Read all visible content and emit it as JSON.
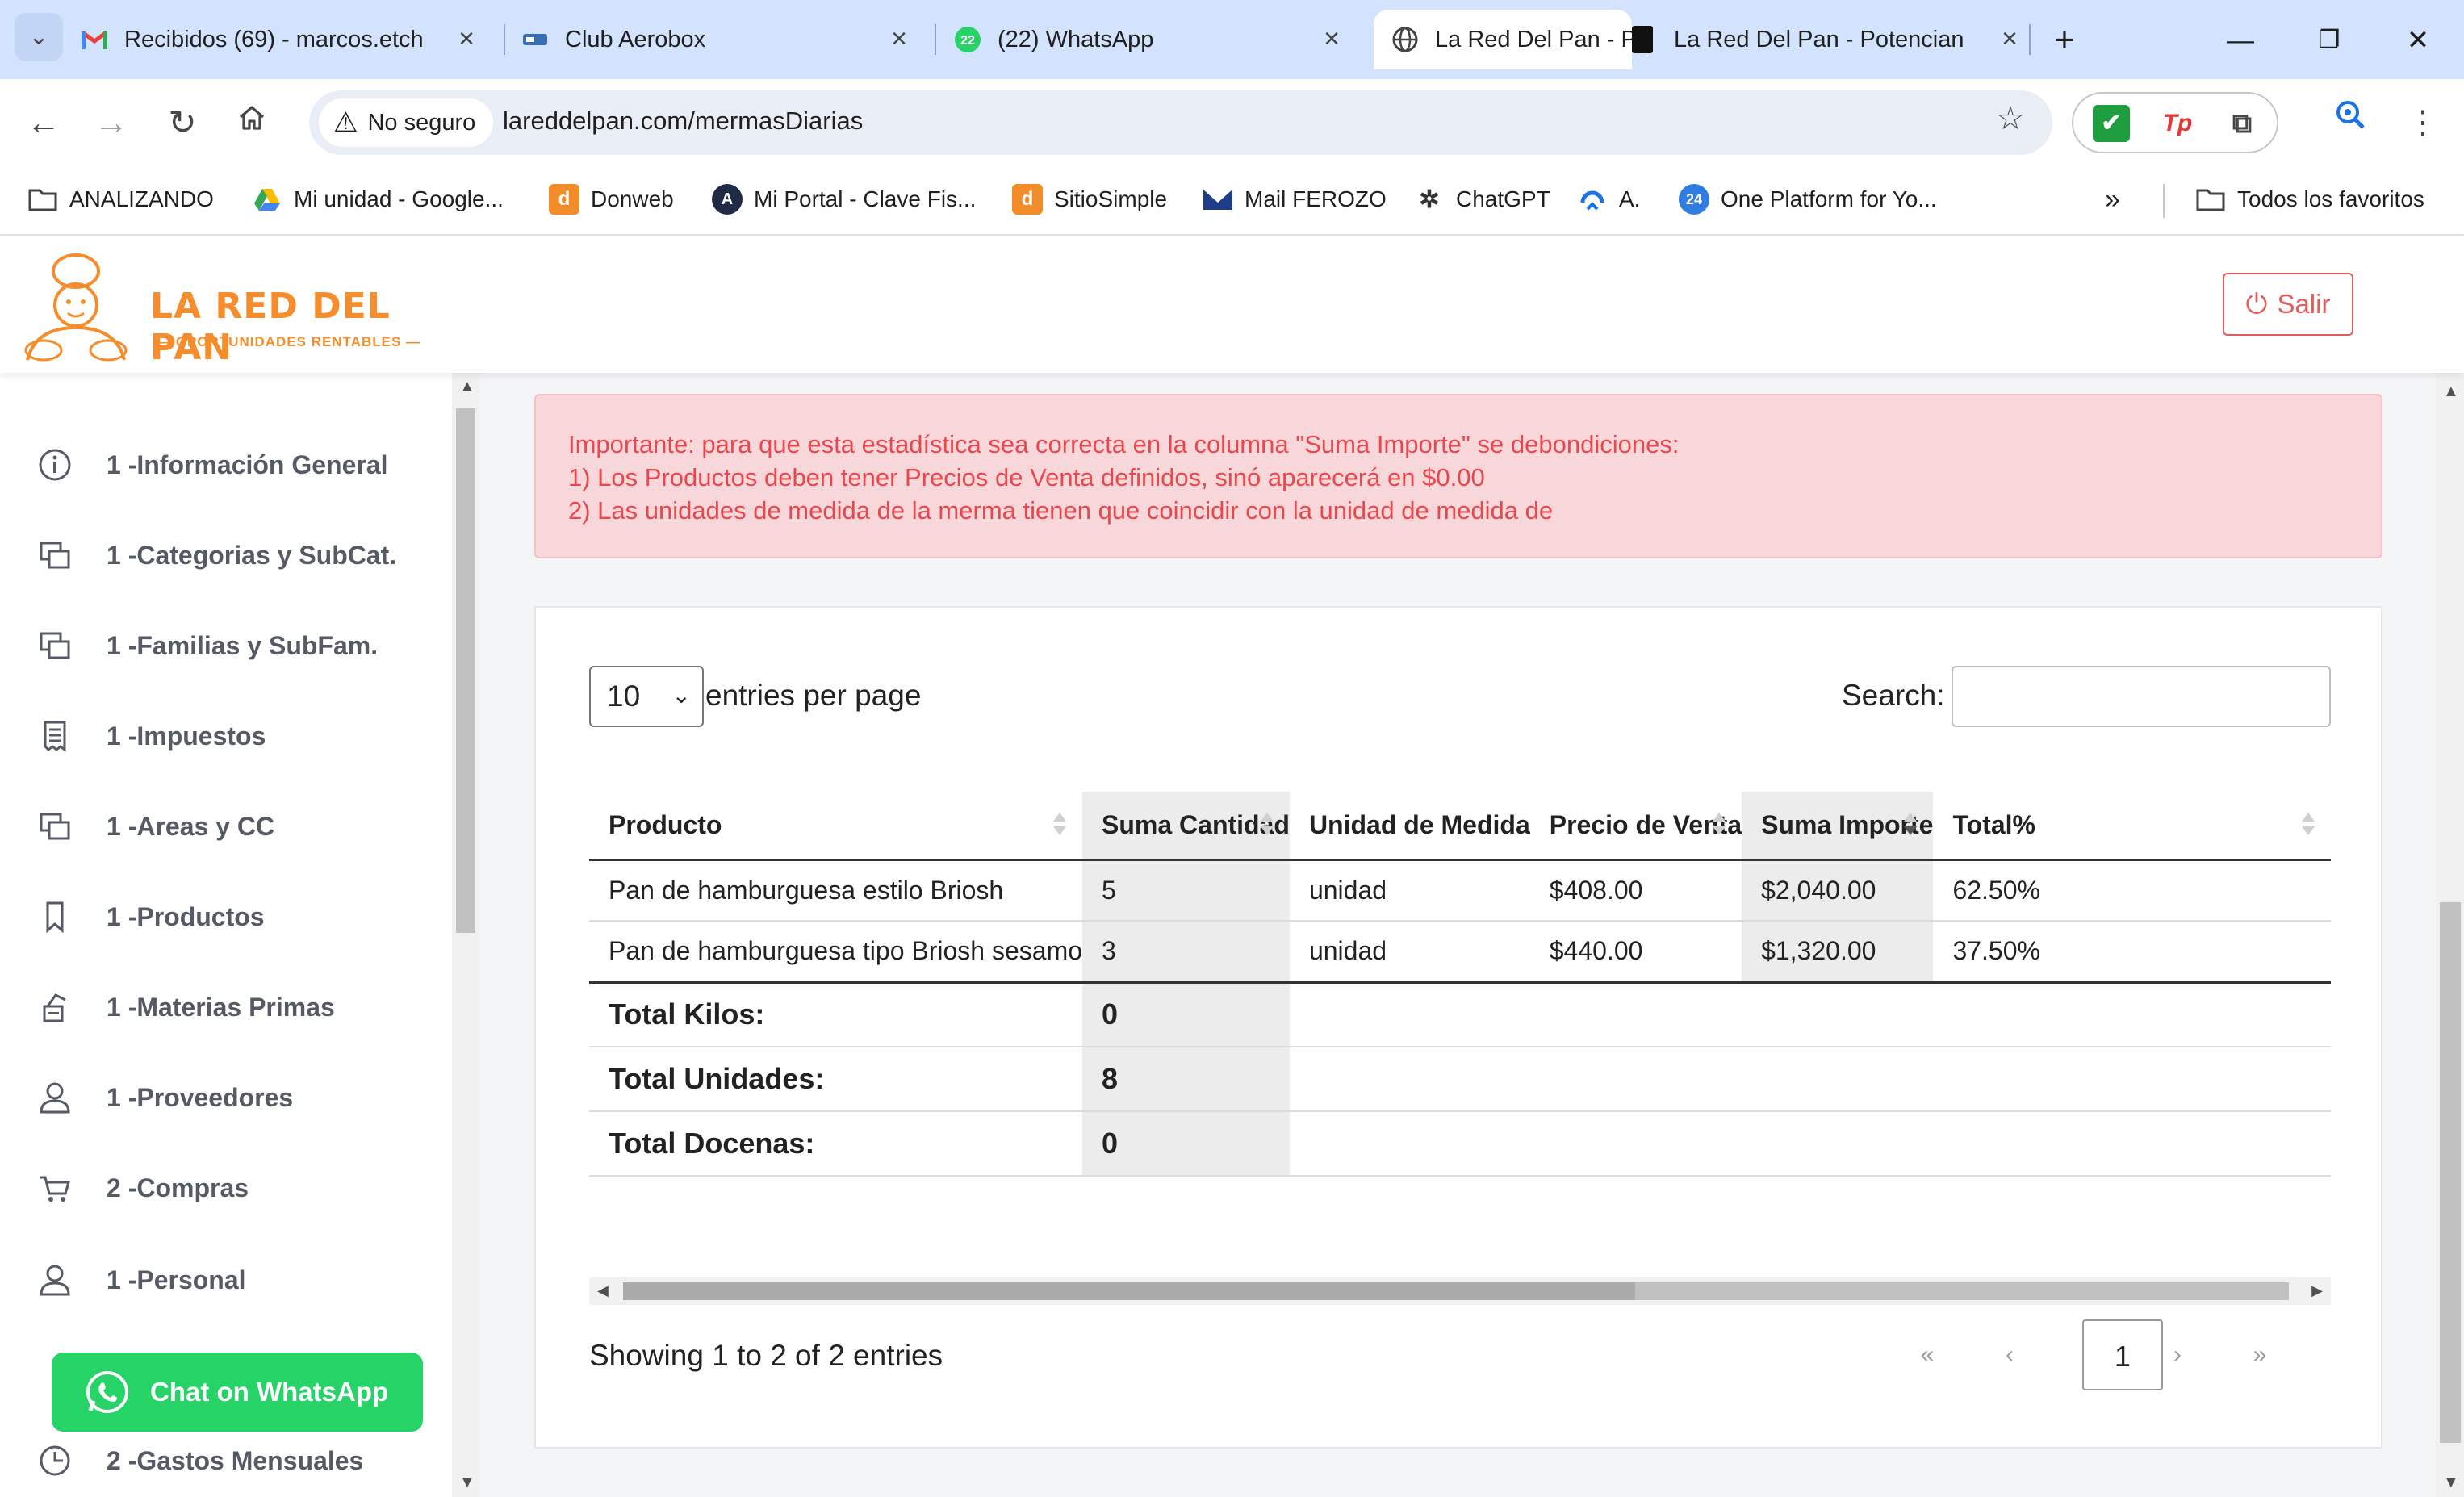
{
  "browser": {
    "tabs": [
      {
        "title": "Recibidos (69) - marcos.etch",
        "icon": "gmail-icon"
      },
      {
        "title": "Club Aerobox",
        "icon": "club-icon"
      },
      {
        "title": "(22) WhatsApp",
        "icon": "whatsapp-icon",
        "badge": "22"
      },
      {
        "title": "La Red Del Pan - Pa",
        "icon": "globe-icon",
        "active": true
      },
      {
        "title": "La Red Del Pan - Potenciand",
        "icon": "site-icon"
      }
    ],
    "new_tab": "+",
    "window_controls": {
      "minimize": "—",
      "restore": "❐",
      "close": "✕"
    },
    "security_label": "No seguro",
    "url": "lareddelpan.com/mermasDiarias",
    "bookmarks": [
      {
        "label": "ANALIZANDO",
        "icon": "folder-icon"
      },
      {
        "label": "Mi unidad - Google...",
        "icon": "drive-icon"
      },
      {
        "label": "Donweb",
        "icon": "donweb-icon"
      },
      {
        "label": "Mi Portal - Clave Fis...",
        "icon": "portal-icon"
      },
      {
        "label": "SitioSimple",
        "icon": "sitiosimple-icon"
      },
      {
        "label": "Mail FEROZO",
        "icon": "mail-icon"
      },
      {
        "label": "ChatGPT",
        "icon": "chatgpt-icon"
      },
      {
        "label": "A.",
        "icon": "a-icon"
      },
      {
        "label": "One Platform for Yo...",
        "icon": "platform-icon"
      }
    ],
    "bookmarks_overflow": "»",
    "all_bookmarks": "Todos los favoritos"
  },
  "site": {
    "logo_text": "LA RED DEL PAN",
    "logo_sub": "OPORTUNIDADES RENTABLES",
    "logout_label": "Salir"
  },
  "sidebar": {
    "items": [
      {
        "label": "1 -Información General",
        "icon": "info-icon"
      },
      {
        "label": "1 -Categorias y SubCat.",
        "icon": "copy-icon"
      },
      {
        "label": "1 -Familias y SubFam.",
        "icon": "copy-icon"
      },
      {
        "label": "1 -Impuestos",
        "icon": "receipt-icon"
      },
      {
        "label": "1 -Areas y CC",
        "icon": "copy-icon"
      },
      {
        "label": "1 -Productos",
        "icon": "bookmark-icon"
      },
      {
        "label": "1 -Materias Primas",
        "icon": "ingredients-icon"
      },
      {
        "label": "1 -Proveedores",
        "icon": "user-icon"
      },
      {
        "label": "2 -Compras",
        "icon": "cart-icon"
      },
      {
        "label": "1 -Personal",
        "icon": "user-icon"
      },
      {
        "label": "2 -Gastos Mensuales",
        "icon": "clock-icon"
      }
    ],
    "whatsapp_label": "Chat on WhatsApp"
  },
  "alert": {
    "lines": [
      "Importante: para que esta estadística sea correcta en la columna \"Suma Importe\" se debondiciones:",
      "1) Los Productos deben tener Precios de Venta definidos, sinó aparecerá en $0.00",
      "2) Las unidades de medida de la merma tienen que coincidir con la unidad de medida de"
    ]
  },
  "table": {
    "page_length": "10",
    "length_label": "entries per page",
    "search_label": "Search:",
    "search_value": "",
    "columns": [
      "Producto",
      "Suma Cantidad",
      "Unidad de Medida",
      "Precio de Venta",
      "Suma Importe",
      "Total%"
    ],
    "rows": [
      [
        "Pan de hamburguesa estilo Briosh",
        "5",
        "unidad",
        "$408.00",
        "$2,040.00",
        "62.50%"
      ],
      [
        "Pan de hamburguesa tipo Briosh sesamo",
        "3",
        "unidad",
        "$440.00",
        "$1,320.00",
        "37.50%"
      ]
    ],
    "totals": [
      {
        "label": "Total Kilos:",
        "value": "0"
      },
      {
        "label": "Total Unidades:",
        "value": "8"
      },
      {
        "label": "Total Docenas:",
        "value": "0"
      }
    ],
    "info": "Showing 1 to 2 of 2 entries",
    "pagination": {
      "first": "«",
      "prev": "‹",
      "current": "1",
      "next": "›",
      "last": "»"
    }
  },
  "colors": {
    "tabbar_bg": "#d3e3fd",
    "brand_orange": "#f58d2d",
    "alert_bg": "#f8d7da",
    "alert_text": "#e8484d",
    "whatsapp_green": "#25d366",
    "logout_red": "#e35d5d"
  }
}
